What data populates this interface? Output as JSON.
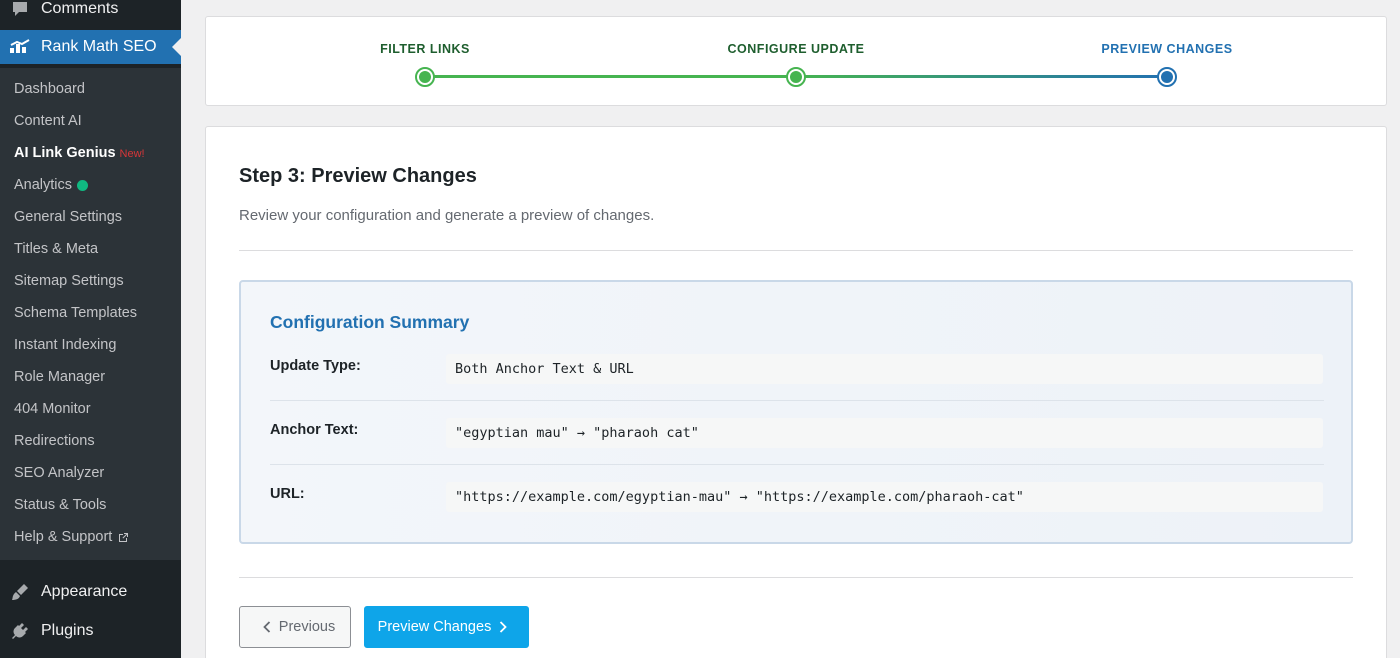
{
  "sidebar": {
    "comments_label": "Comments",
    "rankmath_label": "Rank Math SEO",
    "submenu": [
      {
        "label": "Dashboard"
      },
      {
        "label": "Content AI"
      },
      {
        "label": "AI Link Genius",
        "badge": "New!"
      },
      {
        "label": "Analytics"
      },
      {
        "label": "General Settings"
      },
      {
        "label": "Titles & Meta"
      },
      {
        "label": "Sitemap Settings"
      },
      {
        "label": "Schema Templates"
      },
      {
        "label": "Instant Indexing"
      },
      {
        "label": "Role Manager"
      },
      {
        "label": "404 Monitor"
      },
      {
        "label": "Redirections"
      },
      {
        "label": "SEO Analyzer"
      },
      {
        "label": "Status & Tools"
      },
      {
        "label": "Help & Support"
      }
    ],
    "appearance_label": "Appearance",
    "plugins_label": "Plugins"
  },
  "stepper": {
    "steps": [
      {
        "label": "FILTER LINKS",
        "state": "complete"
      },
      {
        "label": "CONFIGURE UPDATE",
        "state": "complete"
      },
      {
        "label": "PREVIEW CHANGES",
        "state": "active"
      }
    ]
  },
  "main": {
    "title": "Step 3: Preview Changes",
    "description": "Review your configuration and generate a preview of changes.",
    "summary": {
      "title": "Configuration Summary",
      "rows": [
        {
          "label": "Update Type:",
          "value": "Both Anchor Text & URL"
        },
        {
          "label": "Anchor Text:",
          "value": "\"egyptian mau\" → \"pharaoh cat\""
        },
        {
          "label": "URL:",
          "value": "\"https://example.com/egyptian-mau\" → \"https://example.com/pharaoh-cat\""
        }
      ]
    },
    "prev_label": "Previous",
    "next_label": "Preview Changes"
  },
  "colors": {
    "complete": "#46b450",
    "active": "#2271b1",
    "complete_label": "#1e5e2e",
    "active_label": "#2271b1"
  },
  "icons": {
    "comments": "speech-bubble-icon",
    "rankmath": "rank-math-logo-icon",
    "appearance": "paintbrush-icon",
    "plugins": "plug-icon",
    "help_external": "external-link-icon",
    "prev": "chevron-left-icon",
    "next": "chevron-right-icon"
  }
}
